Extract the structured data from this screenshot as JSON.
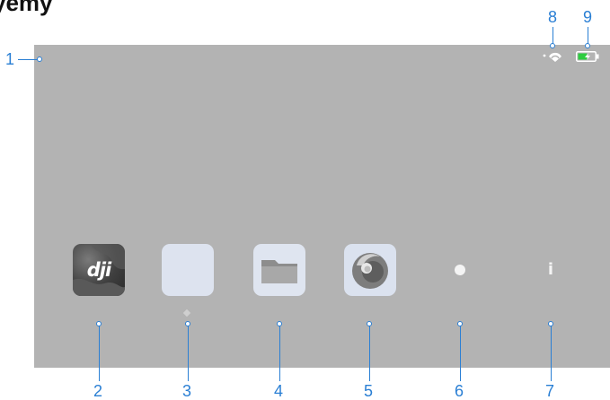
{
  "heading": "yemy",
  "callouts": {
    "c1": "1",
    "c2": "2",
    "c3": "3",
    "c4": "4",
    "c5": "5",
    "c6": "6",
    "c7": "7",
    "c8": "8",
    "c9": "9"
  },
  "apps": {
    "dji_label": "dji"
  },
  "controls": {
    "info_glyph": "i"
  },
  "icons": {
    "status": [
      "wifi-signal-icon",
      "battery-charging-icon"
    ],
    "apps": [
      "dji-app-icon",
      "blank-app-icon",
      "folder-icon",
      "browser-icon"
    ],
    "controls": [
      "record-dot-icon",
      "info-icon"
    ]
  },
  "colors": {
    "callout": "#2a7fd4",
    "screen": "#b3b3b3",
    "battery": "#2ecc40"
  }
}
